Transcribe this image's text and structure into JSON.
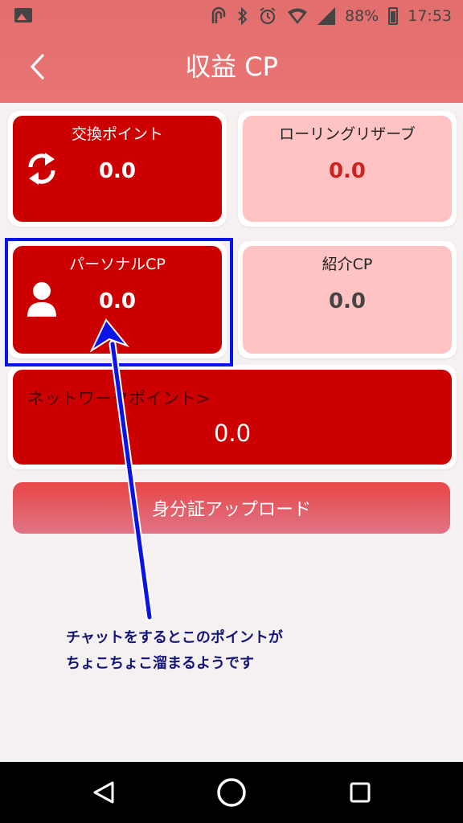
{
  "status_bar": {
    "battery_percent": "88%",
    "time": "17:53"
  },
  "header": {
    "title": "収益 CP"
  },
  "cards": {
    "exchange": {
      "title": "交換ポイント",
      "value": "0.0",
      "icon": "refresh-icon"
    },
    "rolling": {
      "title": "ローリングリザーブ",
      "value": "0.0"
    },
    "personal": {
      "title": "パーソナルCP",
      "value": "0.0",
      "icon": "person-icon"
    },
    "referral": {
      "title": "紹介CP",
      "value": "0.0"
    },
    "network": {
      "title": "ネットワークポイント>",
      "value": "0.0"
    }
  },
  "upload_button": {
    "label": "身分証アップロード"
  },
  "annotation": {
    "line1": "チャットをするとこのポイントが",
    "line2": "ちょこちょこ溜まるようです"
  },
  "colors": {
    "header": "#ea7474",
    "card_red": "#cc0000",
    "card_pink": "#ffc3c3",
    "highlight": "#0a14e6",
    "annotation_text": "#14147a"
  }
}
